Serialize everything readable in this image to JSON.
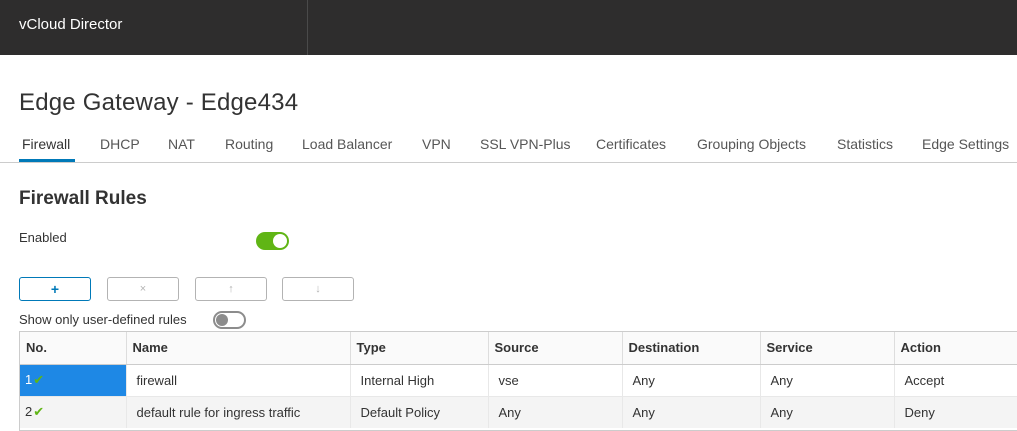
{
  "header": {
    "app_title": "vCloud Director"
  },
  "page": {
    "title": "Edge Gateway - Edge434"
  },
  "tabs": [
    {
      "label": "Firewall",
      "active": true
    },
    {
      "label": "DHCP"
    },
    {
      "label": "NAT"
    },
    {
      "label": "Routing"
    },
    {
      "label": "Load Balancer"
    },
    {
      "label": "VPN"
    },
    {
      "label": "SSL VPN-Plus"
    },
    {
      "label": "Certificates"
    },
    {
      "label": "Grouping Objects"
    },
    {
      "label": "Statistics"
    },
    {
      "label": "Edge Settings"
    }
  ],
  "section": {
    "title": "Firewall Rules",
    "enabled_label": "Enabled",
    "enabled": true
  },
  "toolbar": {
    "add_icon": "+",
    "delete_icon": "×",
    "move_up_icon": "↑",
    "move_down_icon": "↓"
  },
  "filter": {
    "label": "Show only user-defined rules",
    "enabled": false
  },
  "table": {
    "columns": [
      "No.",
      "Name",
      "Type",
      "Source",
      "Destination",
      "Service",
      "Action"
    ],
    "rows": [
      {
        "no": "1",
        "enabled_icon": "✔",
        "name": "firewall",
        "type": "Internal High",
        "source": "vse",
        "destination": "Any",
        "service": "Any",
        "action": "Accept",
        "selected": true
      },
      {
        "no": "2",
        "enabled_icon": "✔",
        "name": "default rule for ingress traffic",
        "type": "Default Policy",
        "source": "Any",
        "destination": "Any",
        "service": "Any",
        "action": "Deny"
      }
    ]
  },
  "colors": {
    "accent": "#0079b8",
    "toggle_on": "#60b515",
    "selection": "#1e88e5",
    "topbar": "#2e2d2d"
  }
}
